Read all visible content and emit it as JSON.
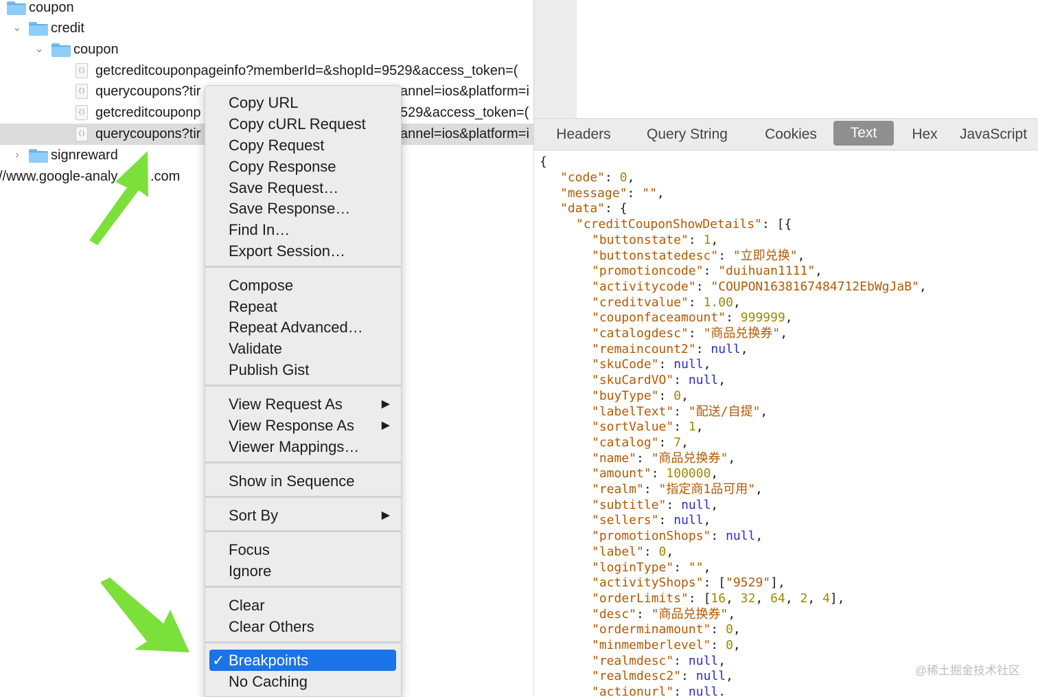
{
  "tree": {
    "rows": [
      {
        "label": "coupon"
      },
      {
        "label": "credit"
      },
      {
        "label": "coupon"
      },
      {
        "label": "getcreditcouponpageinfo?memberId=&shopId=9529&access_token=("
      },
      {
        "label": "querycoupons?tir",
        "suffix": "annel=ios&platform=i"
      },
      {
        "label": "getcreditcouponp",
        "suffix": "529&access_token=("
      },
      {
        "label": "querycoupons?tir",
        "suffix": "annel=ios&platform=i"
      },
      {
        "label": "signreward"
      },
      {
        "label": "//www.google-analy",
        "suffix": ".com"
      }
    ]
  },
  "tabs": [
    "Headers",
    "Query String",
    "Cookies",
    "Text",
    "Hex",
    "JavaScript"
  ],
  "active_tab": "Text",
  "menu": {
    "items": [
      "Copy URL",
      "Copy cURL Request",
      "Copy Request",
      "Copy Response",
      "Save Request…",
      "Save Response…",
      "Find In…",
      "Export Session…",
      "Compose",
      "Repeat",
      "Repeat Advanced…",
      "Validate",
      "Publish Gist",
      "View Request As",
      "View Response As",
      "Viewer Mappings…",
      "Show in Sequence",
      "Sort By",
      "Focus",
      "Ignore",
      "Clear",
      "Clear Others",
      "Breakpoints",
      "No Caching"
    ],
    "check": "✓",
    "submenu_arrow": "▶"
  },
  "json_text": {
    "open": "{",
    "lines": [
      {
        "k": "\"code\"",
        "v": "0",
        "t": "n",
        "indent": 1,
        "end": ","
      },
      {
        "k": "\"message\"",
        "v": "\"\"",
        "t": "s",
        "indent": 1,
        "end": ","
      },
      {
        "k": "\"data\"",
        "v": "{",
        "t": "p",
        "indent": 1,
        "end": ""
      },
      {
        "k": "\"creditCouponShowDetails\"",
        "v": "[{",
        "t": "p",
        "indent": 2,
        "end": ""
      },
      {
        "k": "\"buttonstate\"",
        "v": "1",
        "t": "n",
        "indent": 3,
        "end": ","
      },
      {
        "k": "\"buttonstatedesc\"",
        "v": "\"立即兑换\"",
        "t": "s",
        "indent": 3,
        "end": ","
      },
      {
        "k": "\"promotioncode\"",
        "v": "\"duihuan1111\"",
        "t": "s",
        "indent": 3,
        "end": ","
      },
      {
        "k": "\"activitycode\"",
        "v": "\"COUPON1638167484712EbWgJaB\"",
        "t": "s",
        "indent": 3,
        "end": ","
      },
      {
        "k": "\"creditvalue\"",
        "v": "1.00",
        "t": "n",
        "indent": 3,
        "end": ","
      },
      {
        "k": "\"couponfaceamount\"",
        "v": "999999",
        "t": "n",
        "indent": 3,
        "end": ","
      },
      {
        "k": "\"catalogdesc\"",
        "v": "\"商品兑换券\"",
        "t": "s",
        "indent": 3,
        "end": ","
      },
      {
        "k": "\"remaincount2\"",
        "v": "null",
        "t": "nul",
        "indent": 3,
        "end": ","
      },
      {
        "k": "\"skuCode\"",
        "v": "null",
        "t": "nul",
        "indent": 3,
        "end": ","
      },
      {
        "k": "\"skuCardVO\"",
        "v": "null",
        "t": "nul",
        "indent": 3,
        "end": ","
      },
      {
        "k": "\"buyType\"",
        "v": "0",
        "t": "n",
        "indent": 3,
        "end": ","
      },
      {
        "k": "\"labelText\"",
        "v": "\"配送/自提\"",
        "t": "s",
        "indent": 3,
        "end": ","
      },
      {
        "k": "\"sortValue\"",
        "v": "1",
        "t": "n",
        "indent": 3,
        "end": ","
      },
      {
        "k": "\"catalog\"",
        "v": "7",
        "t": "n",
        "indent": 3,
        "end": ","
      },
      {
        "k": "\"name\"",
        "v": "\"商品兑换券\"",
        "t": "s",
        "indent": 3,
        "end": ","
      },
      {
        "k": "\"amount\"",
        "v": "100000",
        "t": "n",
        "indent": 3,
        "end": ","
      },
      {
        "k": "\"realm\"",
        "v": "\"指定商1品可用\"",
        "t": "s",
        "indent": 3,
        "end": ","
      },
      {
        "k": "\"subtitle\"",
        "v": "null",
        "t": "nul",
        "indent": 3,
        "end": ","
      },
      {
        "k": "\"sellers\"",
        "v": "null",
        "t": "nul",
        "indent": 3,
        "end": ","
      },
      {
        "k": "\"promotionShops\"",
        "v": "null",
        "t": "nul",
        "indent": 3,
        "end": ","
      },
      {
        "k": "\"label\"",
        "v": "0",
        "t": "n",
        "indent": 3,
        "end": ","
      },
      {
        "k": "\"loginType\"",
        "v": "\"\"",
        "t": "s",
        "indent": 3,
        "end": ","
      },
      {
        "k": "\"activityShops\"",
        "v": "[\"9529\"]",
        "t": "arr",
        "indent": 3,
        "end": ","
      },
      {
        "k": "\"orderLimits\"",
        "v": "[16, 32, 64, 2, 4]",
        "t": "arrn",
        "indent": 3,
        "end": ","
      },
      {
        "k": "\"desc\"",
        "v": "\"商品兑换券\"",
        "t": "s",
        "indent": 3,
        "end": ","
      },
      {
        "k": "\"orderminamount\"",
        "v": "0",
        "t": "n",
        "indent": 3,
        "end": ","
      },
      {
        "k": "\"minmemberlevel\"",
        "v": "0",
        "t": "n",
        "indent": 3,
        "end": ","
      },
      {
        "k": "\"realmdesc\"",
        "v": "null",
        "t": "nul",
        "indent": 3,
        "end": ","
      },
      {
        "k": "\"realmdesc2\"",
        "v": "null",
        "t": "nul",
        "indent": 3,
        "end": ","
      },
      {
        "k": "\"actionurl\"",
        "v": "null",
        "t": "nul",
        "indent": 3,
        "end": ","
      }
    ]
  },
  "watermark": "@稀土掘金技术社区",
  "colors": {
    "highlight": "#1a73e8",
    "arrow": "#7be03a"
  }
}
